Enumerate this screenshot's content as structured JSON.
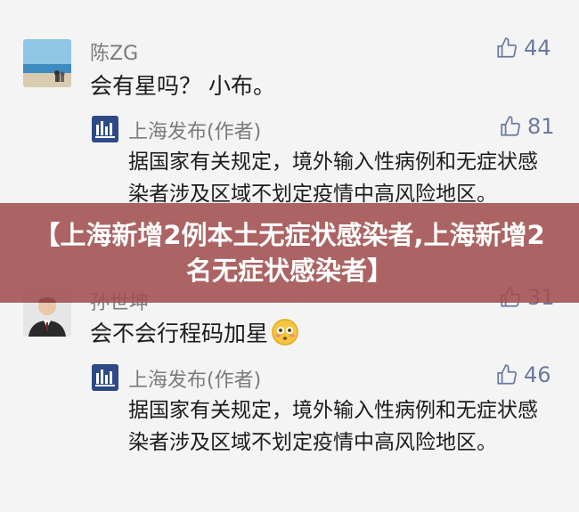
{
  "comments": [
    {
      "name": "陈ZG",
      "text": "会有星吗？ 小布。",
      "likes": "44",
      "reply": {
        "name": "上海发布(作者)",
        "likes": "81",
        "text": "据国家有关规定，境外输入性病例和无症状感染者涉及区域不划定疫情中高风险地区。"
      }
    },
    {
      "name": "孙世坤",
      "text": "会不会行程码加星",
      "emoji": "flushed-face",
      "likes": "31",
      "reply": {
        "name": "上海发布(作者)",
        "likes": "46",
        "text": "据国家有关规定，境外输入性病例和无症状感染者涉及区域不划定疫情中高风险地区。"
      }
    }
  ],
  "banner": {
    "title": "【上海新增2例本土无症状感染者,上海新增2名无症状感染者】"
  },
  "colors": {
    "banner_bg": "#a0504e",
    "like_icon": "#6a7aa0",
    "reply_logo_bg": "#2d4a86"
  }
}
